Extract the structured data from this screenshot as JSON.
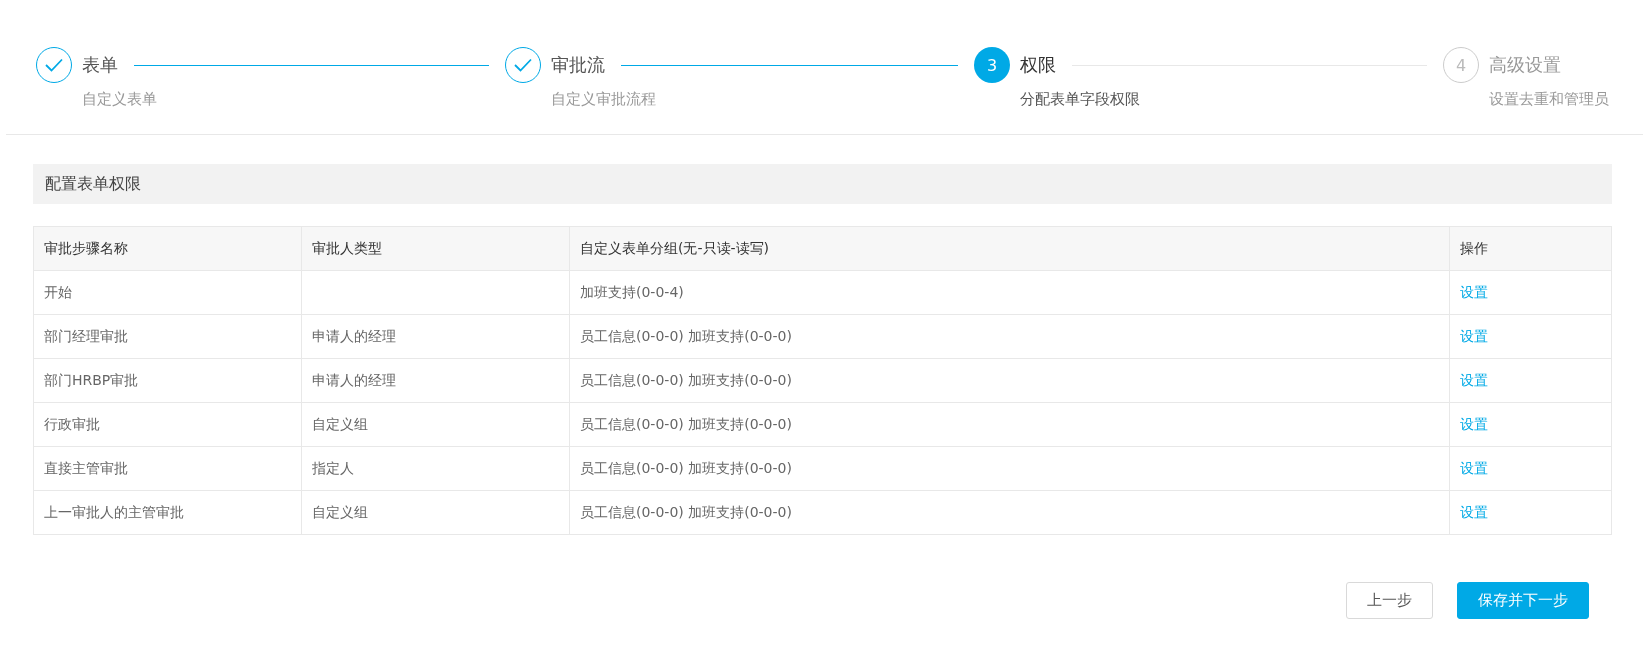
{
  "steps": [
    {
      "title": "表单",
      "description": "自定义表单",
      "kind": "finish"
    },
    {
      "title": "审批流",
      "description": "自定义审批流程",
      "kind": "finish"
    },
    {
      "number": "3",
      "title": "权限",
      "description": "分配表单字段权限",
      "kind": "process"
    },
    {
      "number": "4",
      "title": "高级设置",
      "description": "设置去重和管理员",
      "kind": "wait"
    }
  ],
  "section": {
    "title": "配置表单权限"
  },
  "table": {
    "columns": [
      "审批步骤名称",
      "审批人类型",
      "自定义表单分组(无-只读-读写)",
      "操作"
    ],
    "rows": [
      {
        "step": "开始",
        "groups": "加班支持(0-0-4)",
        "action": "设置"
      },
      {
        "step": "部门经理审批",
        "approver_type": "申请人的经理",
        "groups": "员工信息(0-0-0) 加班支持(0-0-0)",
        "action": "设置"
      },
      {
        "step": "部门HRBP审批",
        "approver_type": "申请人的经理",
        "groups": "员工信息(0-0-0) 加班支持(0-0-0)",
        "action": "设置"
      },
      {
        "step": "行政审批",
        "approver_type": "自定义组",
        "groups": "员工信息(0-0-0) 加班支持(0-0-0)",
        "action": "设置"
      },
      {
        "step": "直接主管审批",
        "approver_type": "指定人",
        "groups": "员工信息(0-0-0) 加班支持(0-0-0)",
        "action": "设置"
      },
      {
        "step": "上一审批人的主管审批",
        "approver_type": "自定义组",
        "groups": "员工信息(0-0-0) 加班支持(0-0-0)",
        "action": "设置"
      }
    ]
  },
  "buttons": [
    {
      "label": "上一步",
      "kind": "default"
    },
    {
      "label": "保存并下一步",
      "kind": "primary"
    }
  ]
}
